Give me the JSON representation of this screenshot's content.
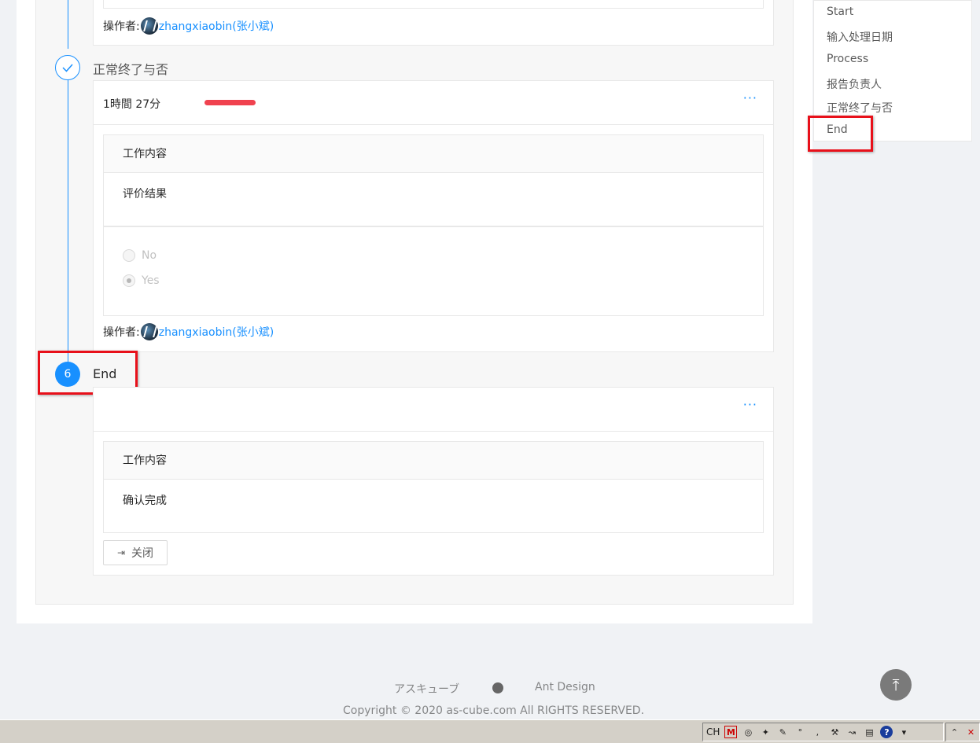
{
  "timeline": {
    "step5": {
      "title": "正常终了与否",
      "duration": "1時間 27分"
    },
    "step6": {
      "number": "6",
      "title": "End"
    }
  },
  "operator": {
    "label": "操作者:",
    "user": "zhangxiaobin(张小斌)"
  },
  "sections": {
    "work_header": "工作内容",
    "eval_result": "评价结果",
    "radio_no": "No",
    "radio_yes": "Yes",
    "confirm_done": "确认完成"
  },
  "card_more": "···",
  "close_button": {
    "icon": "⇥",
    "label": "关闭"
  },
  "anchor_nav": [
    "Start",
    "输入处理日期",
    "Process",
    "报告负责人",
    "正常终了与否",
    "End"
  ],
  "footer": {
    "link1": "アスキューブ",
    "link3": "Ant Design",
    "copyright": "Copyright © 2020 as-cube.com All RIGHTS RESERVED."
  },
  "back_to_top": "⤒",
  "taskbar": {
    "lang": "CH"
  }
}
